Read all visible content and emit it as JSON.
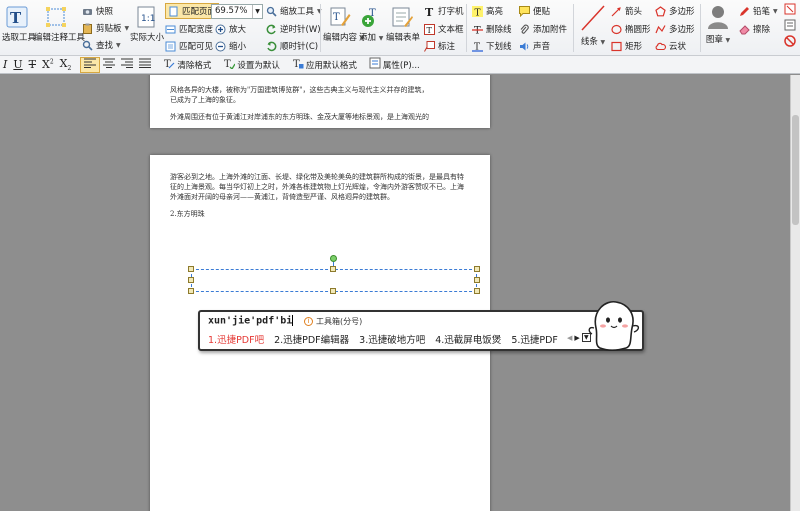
{
  "ribbon": {
    "select_tool": "选取工具",
    "edit_annot_tool": "编辑注释工具",
    "snapshot": "快照",
    "clipboard": "剪贴板",
    "find": "查找",
    "actual_size": "实际大小",
    "fit_page": "匹配页面",
    "fit_width": "匹配宽度",
    "fit_visible": "匹配可见",
    "zoom_value": "69.57%",
    "zoom_in": "放大",
    "zoom_out": "缩小",
    "zoom_tool": "缩放工具",
    "rotate_ccw": "逆时针(W)",
    "rotate_cw": "顺时针(C)",
    "edit_content": "编辑内容",
    "add": "添加",
    "edit_form": "编辑表单",
    "typewriter": "打字机",
    "textbox": "文本框",
    "callout": "标注",
    "highlight": "高亮",
    "strikeout": "删除线",
    "underline": "下划线",
    "note": "便贴",
    "attach": "添加附件",
    "sound": "声音",
    "line": "线条",
    "arrow": "箭头",
    "oval": "椭圆形",
    "rect": "矩形",
    "polygon": "多边形",
    "polyline": "多边形",
    "cloud": "云状",
    "stamp": "图章",
    "pencil": "铅笔",
    "eraser": "擦除"
  },
  "format_bar": {
    "clear_format": "清除格式",
    "set_default": "设置为默认",
    "apply_default": "应用默认格式",
    "properties": "属性(P)..."
  },
  "page1": {
    "line1": "风格各异的大楼，被称为\"万国建筑博览群\"，这些古典主义与现代主义并存的建筑，",
    "line2": "已成为了上海的象征。",
    "para2": "外滩周围还有位于黄浦江对岸浦东的东方明珠、金茂大厦等地标景观，是上海观光的"
  },
  "page2": {
    "para1": "游客必到之地。上海外滩的江面、长堤、绿化带及美轮美奂的建筑群所构成的街景，是最具有特征的上海景观。每当华灯初上之时，外滩各栋建筑物上灯光辉煌，令海内外游客赞叹不已。上海外滩面对开阔的母亲河——黄浦江，背倚造型严谨、风格迥异的建筑群。",
    "heading": "2.东方明珠"
  },
  "ime": {
    "composition": "xun'jie'pdf'bi",
    "tip": "工具箱(分号)",
    "candidates": [
      "1.迅捷PDF吧",
      "2.迅捷PDF编辑器",
      "3.迅捷破地方吧",
      "4.迅截屏电饭煲",
      "5.迅捷PDF"
    ]
  },
  "colors": {
    "accent": "#3a7bd5",
    "candidate_selected": "#e53935"
  }
}
